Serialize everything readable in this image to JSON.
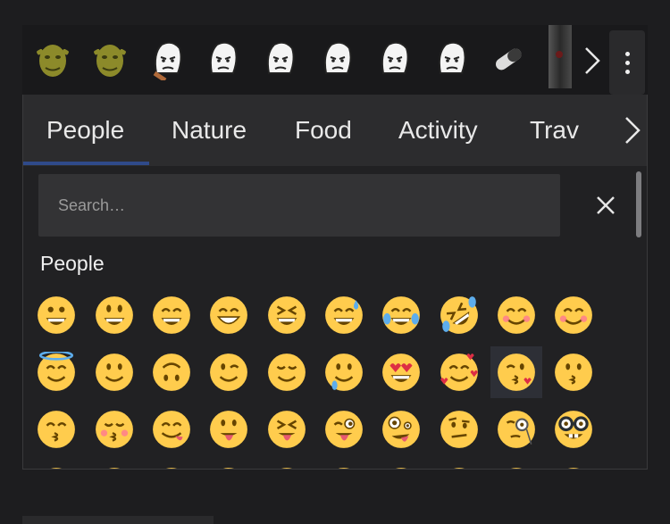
{
  "colors": {
    "emoji_face": "#FFCC4D",
    "emoji_feature": "#664500",
    "accent_underline": "#2F4A8A"
  },
  "stickers": {
    "items": [
      {
        "icon": "shrek-sticker-icon",
        "kind": "shrek"
      },
      {
        "icon": "shrek-sticker-icon",
        "kind": "shrek"
      },
      {
        "icon": "crying-wojak-sticker-icon",
        "kind": "wojak"
      },
      {
        "icon": "crying-wojak-sticker-icon",
        "kind": "wojak"
      },
      {
        "icon": "wojak-sticker-icon",
        "kind": "wojak"
      },
      {
        "icon": "glasses-wojak-sticker-icon",
        "kind": "wojak"
      },
      {
        "icon": "lying-wojak-sticker-icon",
        "kind": "wojak"
      },
      {
        "icon": "thinking-wojak-sticker-icon",
        "kind": "wojak"
      },
      {
        "icon": "pill-sticker-icon",
        "kind": "pill"
      },
      {
        "icon": "dark-sticker-icon",
        "kind": "dark"
      }
    ],
    "next_icon": "chevron-right-icon",
    "menu_icon": "more-vertical-icon"
  },
  "tabs": [
    "People",
    "Nature",
    "Food",
    "Activity",
    "Trav"
  ],
  "active_tab": "People",
  "search": {
    "placeholder": "Search…",
    "clear_icon": "close-icon"
  },
  "section_title": "People",
  "emojis": [
    {
      "icon": "grinning-face-icon"
    },
    {
      "icon": "grinning-face-big-eyes-icon"
    },
    {
      "icon": "grinning-face-smiling-eyes-icon"
    },
    {
      "icon": "beaming-face-icon"
    },
    {
      "icon": "grinning-squinting-face-icon"
    },
    {
      "icon": "grinning-face-sweat-icon"
    },
    {
      "icon": "face-tears-of-joy-icon"
    },
    {
      "icon": "rolling-on-floor-laughing-icon"
    },
    {
      "icon": "smiling-face-icon"
    },
    {
      "icon": "smiling-face-smiling-eyes-icon"
    },
    {
      "icon": "smiling-face-halo-icon"
    },
    {
      "icon": "slightly-smiling-face-icon"
    },
    {
      "icon": "upside-down-face-icon"
    },
    {
      "icon": "winking-face-icon"
    },
    {
      "icon": "relieved-face-icon"
    },
    {
      "icon": "smiling-face-with-tear-icon"
    },
    {
      "icon": "heart-eyes-face-icon"
    },
    {
      "icon": "smiling-face-hearts-icon"
    },
    {
      "icon": "face-blowing-kiss-icon"
    },
    {
      "icon": "kissing-face-icon"
    },
    {
      "icon": "kissing-face-smiling-eyes-icon"
    },
    {
      "icon": "kissing-face-closed-eyes-icon"
    },
    {
      "icon": "face-savoring-food-icon"
    },
    {
      "icon": "face-with-tongue-icon"
    },
    {
      "icon": "squinting-face-tongue-icon"
    },
    {
      "icon": "winking-face-tongue-icon"
    },
    {
      "icon": "zany-face-icon"
    },
    {
      "icon": "face-raised-eyebrow-icon"
    },
    {
      "icon": "face-with-monocle-icon"
    },
    {
      "icon": "nerd-face-icon"
    }
  ]
}
